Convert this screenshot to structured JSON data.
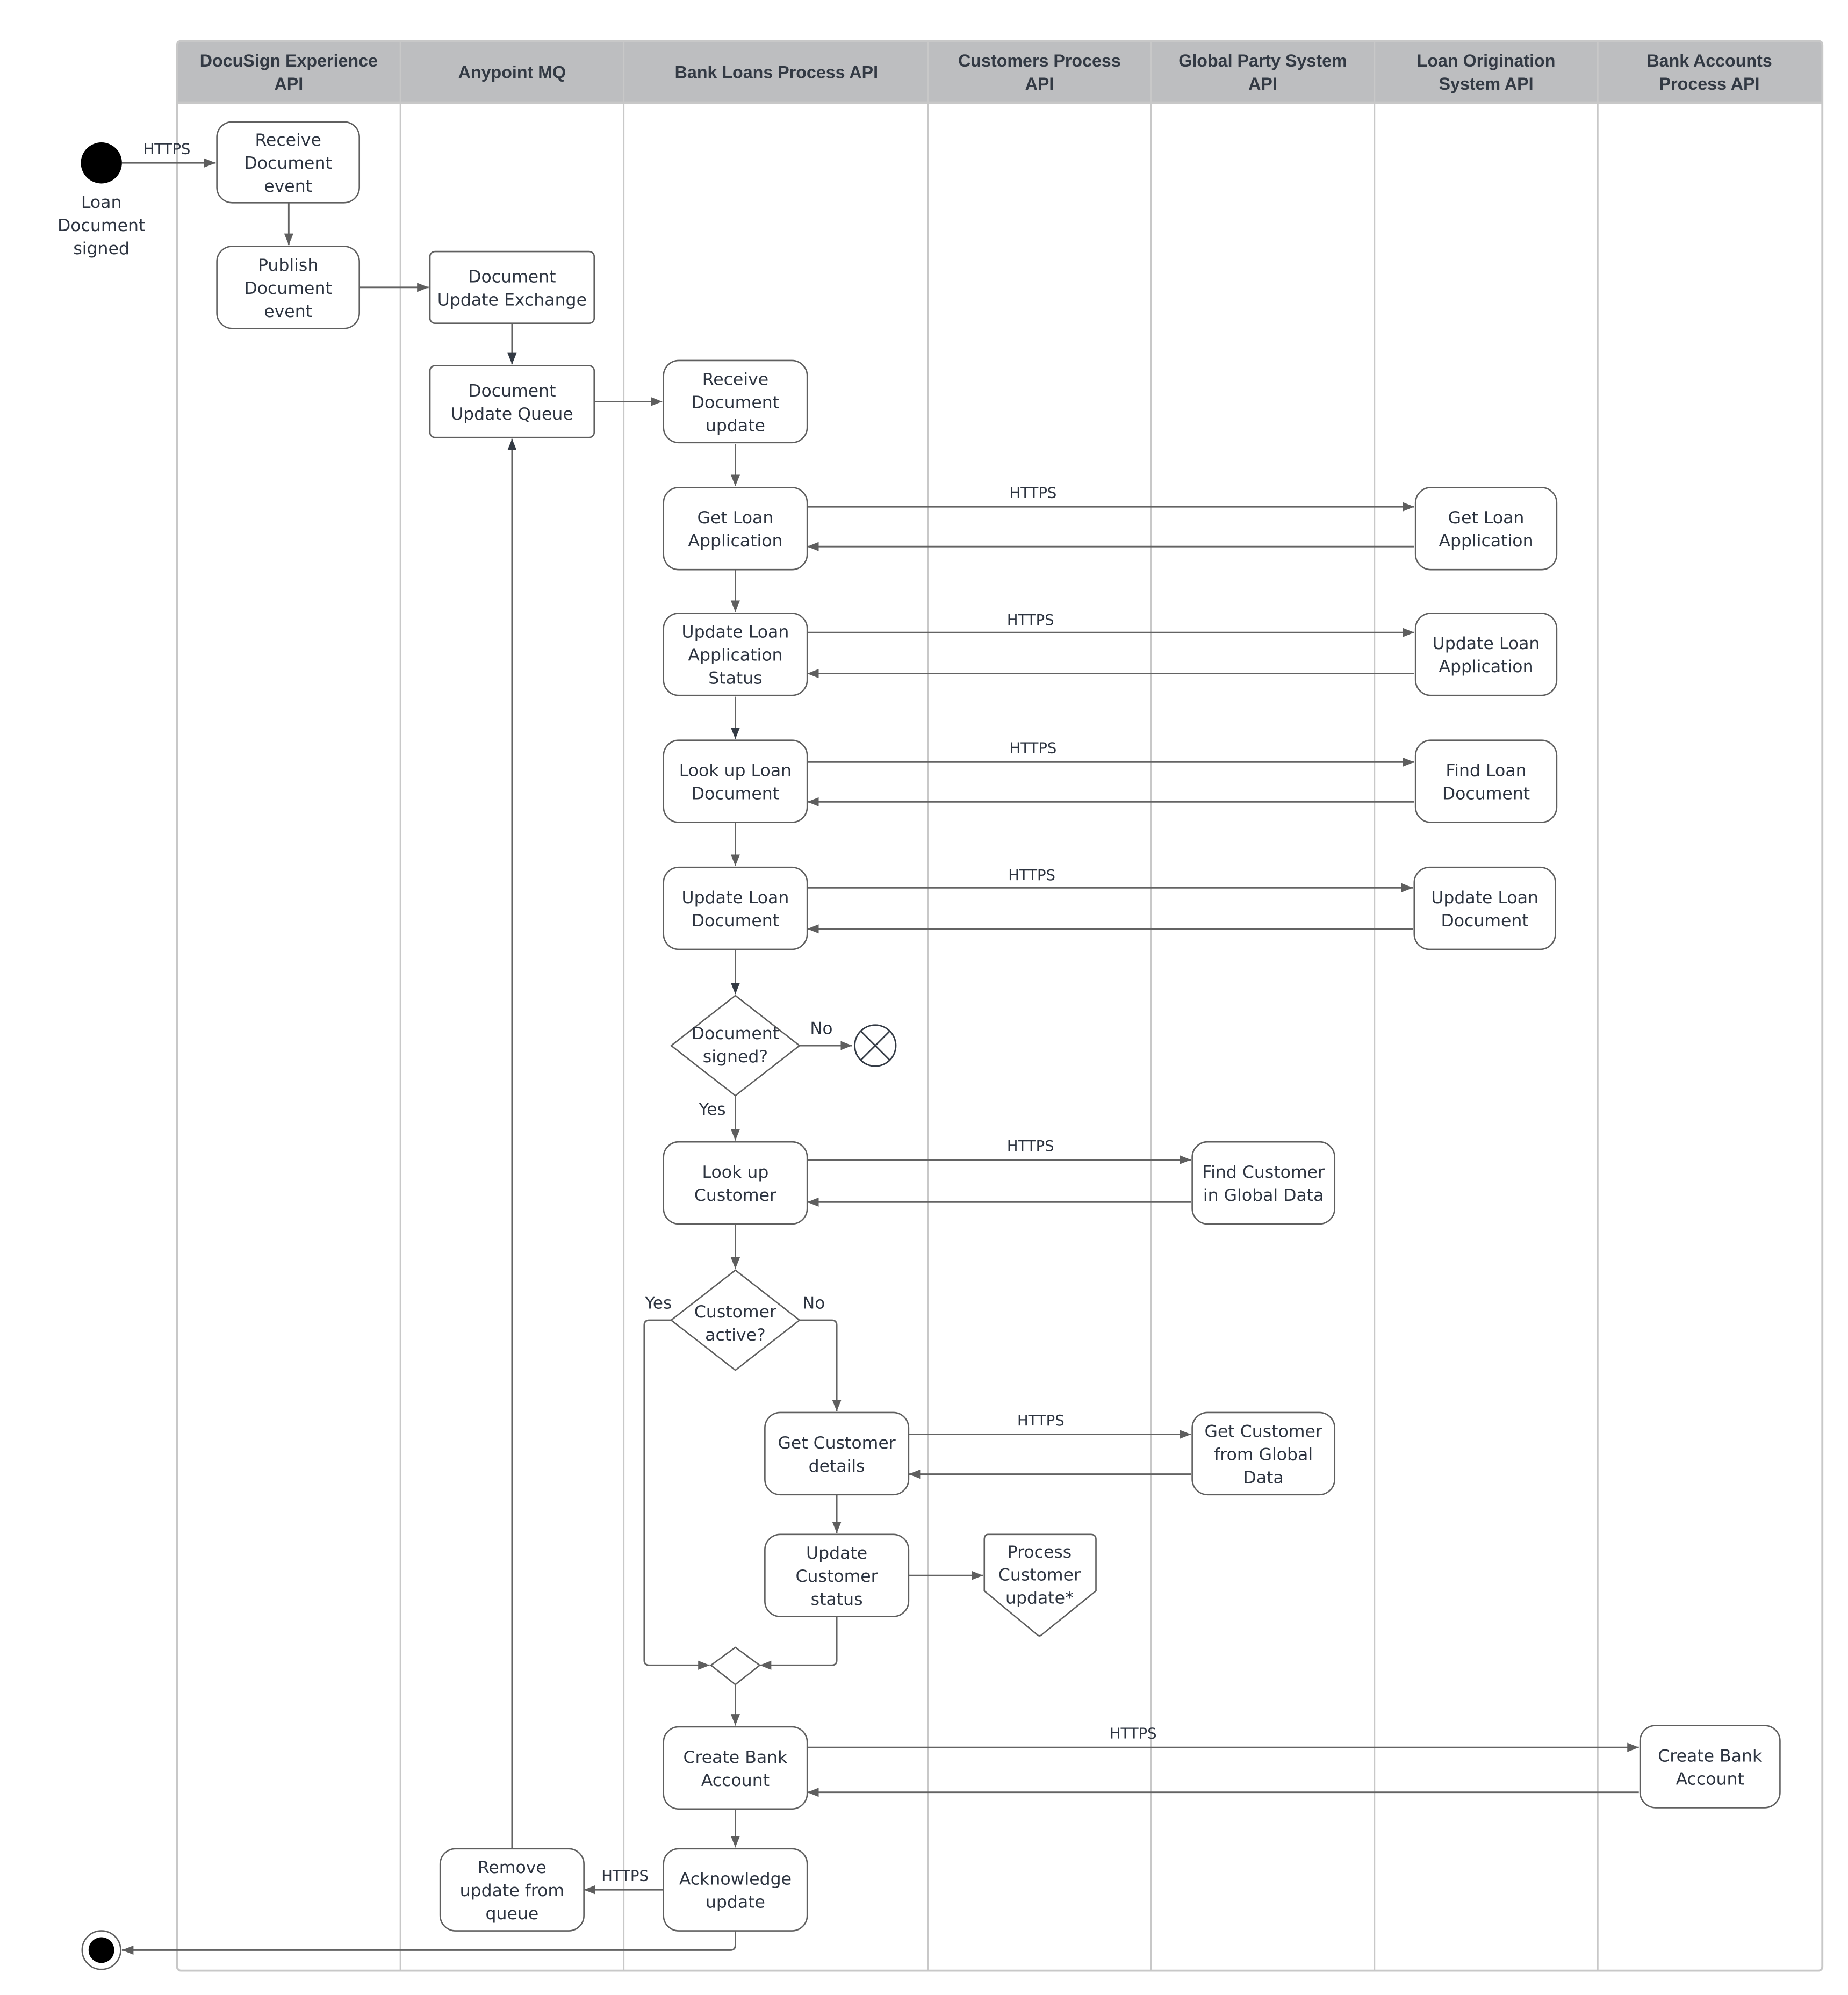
{
  "diagram": {
    "type": "swimlane-activity",
    "lanes": [
      {
        "id": "docusign",
        "label": "DocuSign Experience API"
      },
      {
        "id": "anypoint",
        "label": "Anypoint MQ"
      },
      {
        "id": "bankloans",
        "label": "Bank Loans Process API"
      },
      {
        "id": "customers",
        "label": "Customers Process API"
      },
      {
        "id": "globalparty",
        "label": "Global Party System API"
      },
      {
        "id": "loanorig",
        "label": "Loan Origination System API"
      },
      {
        "id": "bankaccounts",
        "label": "Bank Accounts Process API"
      }
    ],
    "start": {
      "label": "Loan Document signed"
    },
    "nodes": {
      "receive_doc_event": {
        "lane": "docusign",
        "label": "Receive Document event"
      },
      "publish_doc_event": {
        "lane": "docusign",
        "label": "Publish Document event"
      },
      "doc_update_exchange": {
        "lane": "anypoint",
        "label": "Document Update Exchange"
      },
      "doc_update_queue": {
        "lane": "anypoint",
        "label": "Document Update Queue"
      },
      "remove_update": {
        "lane": "anypoint",
        "label": "Remove update from queue"
      },
      "receive_doc_update": {
        "lane": "bankloans",
        "label": "Receive Document update"
      },
      "get_loan_app": {
        "lane": "bankloans",
        "label": "Get Loan Application"
      },
      "update_loan_app_status": {
        "lane": "bankloans",
        "label": "Update Loan Application Status"
      },
      "lookup_loan_doc": {
        "lane": "bankloans",
        "label": "Look up Loan Document"
      },
      "update_loan_doc": {
        "lane": "bankloans",
        "label": "Update Loan Document"
      },
      "doc_signed_decision": {
        "lane": "bankloans",
        "label": "Document signed?"
      },
      "lookup_customer": {
        "lane": "bankloans",
        "label": "Look up Customer"
      },
      "customer_active_decision": {
        "lane": "bankloans",
        "label": "Customer active?"
      },
      "get_customer_details": {
        "lane": "bankloans",
        "label": "Get Customer details"
      },
      "update_customer_status": {
        "lane": "bankloans",
        "label": "Update Customer status"
      },
      "create_bank_account": {
        "lane": "bankloans",
        "label": "Create Bank Account"
      },
      "acknowledge_update": {
        "lane": "bankloans",
        "label": "Acknowledge update"
      },
      "process_customer_update": {
        "lane": "customers",
        "label": "Process Customer update*"
      },
      "find_customer_global": {
        "lane": "globalparty",
        "label": "Find Customer in Global Data"
      },
      "get_customer_global": {
        "lane": "globalparty",
        "label": "Get Customer from Global Data"
      },
      "los_get_loan_app": {
        "lane": "loanorig",
        "label": "Get Loan Application"
      },
      "los_update_loan_app": {
        "lane": "loanorig",
        "label": "Update Loan Application"
      },
      "los_find_loan_doc": {
        "lane": "loanorig",
        "label": "Find Loan Document"
      },
      "los_update_loan_doc": {
        "lane": "loanorig",
        "label": "Update Loan Document"
      },
      "ba_create_bank_account": {
        "lane": "bankaccounts",
        "label": "Create Bank Account"
      }
    },
    "edge_labels": {
      "https": "HTTPS",
      "yes": "Yes",
      "no": "No"
    },
    "colors": {
      "lane_header": "#bdbec0",
      "lane_border": "#c8c8c8",
      "node_stroke": "#5f5f5f",
      "edge": "#636363",
      "text": "#2d3440",
      "start_fill": "#000000"
    }
  }
}
